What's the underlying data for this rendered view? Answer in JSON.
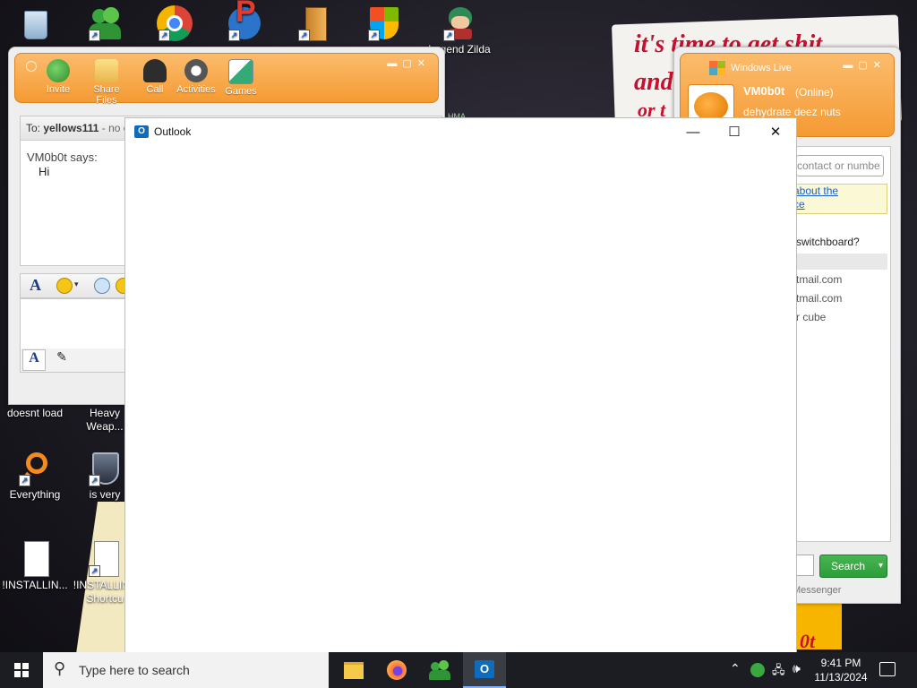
{
  "desktop": {
    "icons": [
      {
        "label": ""
      },
      {
        "label": ""
      },
      {
        "label": ""
      },
      {
        "label": ""
      },
      {
        "label": ""
      },
      {
        "label": ""
      },
      {
        "label": "Legend Zilda"
      },
      {
        "label": "doesnt load"
      },
      {
        "label": "Heavy Weap..."
      },
      {
        "label": "Everything"
      },
      {
        "label": "is very"
      },
      {
        "label": "!INSTALLIN..."
      },
      {
        "label": "!INSTALLIN - Shortcu"
      }
    ],
    "wallpaper_text": [
      "it's time to get shit",
      "and",
      "or t"
    ],
    "wallpaper_fragment": "0t"
  },
  "chat_window": {
    "toolbar": [
      {
        "label": "Invite",
        "icon": "invite-icon"
      },
      {
        "label": "Share Files",
        "icon": "folder-icon"
      },
      {
        "label": "Call",
        "icon": "phone-icon"
      },
      {
        "label": "Activities",
        "icon": "activities-icon"
      },
      {
        "label": "Games",
        "icon": "games-icon"
      }
    ],
    "to_label": "To:",
    "to_value": "yellows111",
    "to_suffix": "- no c",
    "sender": "VM0b0t says:",
    "message": "Hi",
    "side_tag": "HMA"
  },
  "contacts_window": {
    "title": "Windows Live",
    "username": "VM0b0t",
    "status": "(Online)",
    "personal_message": "dehydrate deez nuts",
    "search_placeholder": "contact or numbe",
    "info_link_1": "about the",
    "info_link_2": "ce",
    "question": "switchboard?",
    "list_items": [
      "tmail.com",
      "tmail.com",
      "r cube"
    ],
    "search_button": "Search",
    "footer": "Messenger"
  },
  "outlook": {
    "title": "Outlook",
    "minimize": "—",
    "maximize": "☐",
    "close": "✕"
  },
  "taskbar": {
    "search_placeholder": "Type here to search",
    "time": "9:41 PM",
    "date": "11/13/2024"
  },
  "colors": {
    "accent_orange": "#f59a33",
    "taskbar": "#1b1d22",
    "search_green": "#2c9d3a"
  }
}
